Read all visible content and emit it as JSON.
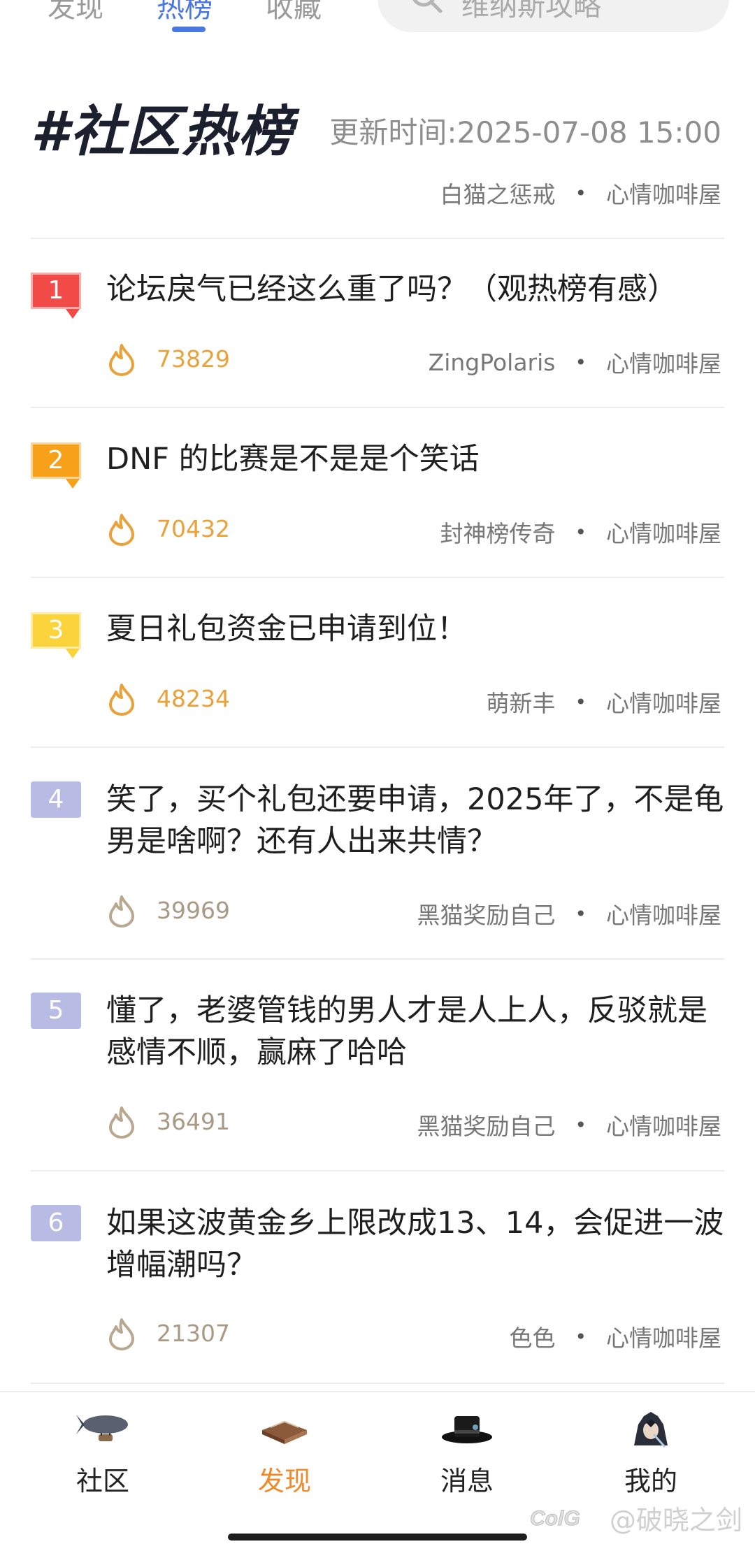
{
  "top_tabs": [
    "发现",
    "热榜",
    "收藏"
  ],
  "search_placeholder": "维纳斯攻略",
  "header": {
    "title": "#社区热榜",
    "update_time": "更新时间:2025-07-08 15:00",
    "author": "白猫之惩戒",
    "board": "心情咖啡屋"
  },
  "items": [
    {
      "rank": "1",
      "title": "论坛戾气已经这么重了吗？（观热榜有感）",
      "heat": "73829",
      "author": "ZingPolaris",
      "board": "心情咖啡屋"
    },
    {
      "rank": "2",
      "title": "DNF 的比赛是不是是个笑话",
      "heat": "70432",
      "author": "封神榜传奇",
      "board": "心情咖啡屋"
    },
    {
      "rank": "3",
      "title": "夏日礼包资金已申请到位！",
      "heat": "48234",
      "author": "萌新丰",
      "board": "心情咖啡屋"
    },
    {
      "rank": "4",
      "title": "笑了，买个礼包还要申请，2025年了，不是龟男是啥啊？还有人出来共情？",
      "heat": "39969",
      "author": "黑猫奖励自己",
      "board": "心情咖啡屋"
    },
    {
      "rank": "5",
      "title": "懂了，老婆管钱的男人才是人上人，反驳就是感情不顺，赢麻了哈哈",
      "heat": "36491",
      "author": "黑猫奖励自己",
      "board": "心情咖啡屋"
    },
    {
      "rank": "6",
      "title": "如果这波黄金乡上限改成13、14，会促进一波增幅潮吗？",
      "heat": "21307",
      "author": "色色",
      "board": "心情咖啡屋"
    }
  ],
  "bottom_nav": [
    {
      "label": "社区",
      "icon": "airship-icon"
    },
    {
      "label": "发现",
      "icon": "book-icon"
    },
    {
      "label": "消息",
      "icon": "top-hat-icon"
    },
    {
      "label": "我的",
      "icon": "avatar-icon"
    }
  ],
  "watermark": "@破晓之剑",
  "colors": {
    "accent": "#4a78e0",
    "nav_active": "#f08a2a",
    "rank1": "#f24a47",
    "rank2": "#f7a11a",
    "rank3": "#fbd33a",
    "rank_other": "#b8bbe3"
  }
}
